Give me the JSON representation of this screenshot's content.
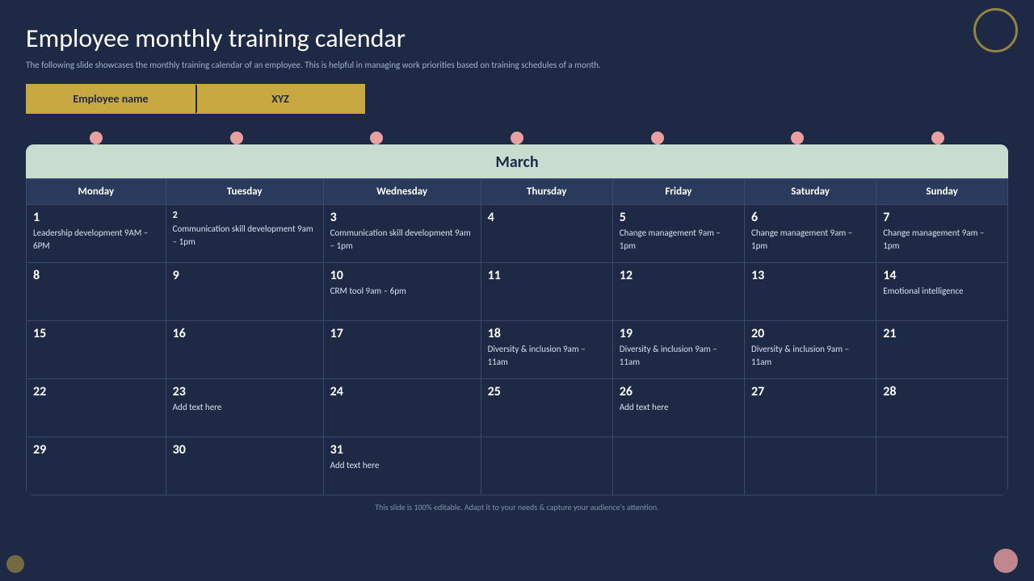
{
  "page": {
    "title": "Employee monthly training calendar",
    "subtitle": "The following slide showcases the monthly training calendar of an employee. This is helpful in managing work priorities based on training schedules of a month.",
    "footer": "This slide is 100% editable. Adapt it to your needs & capture your audience's attention."
  },
  "employee": {
    "label": "Employee name",
    "value": "XYZ"
  },
  "calendar": {
    "month": "March",
    "days": [
      "Monday",
      "Tuesday",
      "Wednesday",
      "Thursday",
      "Friday",
      "Saturday",
      "Sunday"
    ]
  },
  "rows": [
    [
      {
        "num": "1",
        "event": "Leadership development\n9AM – 6PM"
      },
      {
        "num": "2",
        "event": "Communication skill development\n9am – 1pm"
      },
      {
        "num": "3",
        "event": "Communication skill development\n9am – 1pm"
      },
      {
        "num": "4",
        "event": ""
      },
      {
        "num": "5",
        "event": "Change management\n9am – 1pm"
      },
      {
        "num": "6",
        "event": "Change management\n9am – 1pm"
      },
      {
        "num": "7",
        "event": "Change management\n9am – 1pm"
      }
    ],
    [
      {
        "num": "8",
        "event": ""
      },
      {
        "num": "9",
        "event": ""
      },
      {
        "num": "10",
        "event": "CRM tool\n9am – 6pm"
      },
      {
        "num": "11",
        "event": ""
      },
      {
        "num": "12",
        "event": ""
      },
      {
        "num": "13",
        "event": ""
      },
      {
        "num": "14",
        "event": "Emotional intelligence"
      }
    ],
    [
      {
        "num": "15",
        "event": ""
      },
      {
        "num": "16",
        "event": ""
      },
      {
        "num": "17",
        "event": ""
      },
      {
        "num": "18",
        "event": "Diversity & inclusion\n9am – 11am"
      },
      {
        "num": "19",
        "event": "Diversity & inclusion\n9am – 11am"
      },
      {
        "num": "20",
        "event": "Diversity & inclusion\n9am – 11am"
      },
      {
        "num": "21",
        "event": ""
      }
    ],
    [
      {
        "num": "22",
        "event": ""
      },
      {
        "num": "23",
        "event": "Add text here"
      },
      {
        "num": "24",
        "event": ""
      },
      {
        "num": "25",
        "event": ""
      },
      {
        "num": "26",
        "event": "Add text here"
      },
      {
        "num": "27",
        "event": ""
      },
      {
        "num": "28",
        "event": ""
      }
    ],
    [
      {
        "num": "29",
        "event": ""
      },
      {
        "num": "30",
        "event": ""
      },
      {
        "num": "31",
        "event": "Add text here"
      },
      {
        "num": "",
        "event": ""
      },
      {
        "num": "",
        "event": ""
      },
      {
        "num": "",
        "event": ""
      },
      {
        "num": "",
        "event": ""
      }
    ]
  ]
}
